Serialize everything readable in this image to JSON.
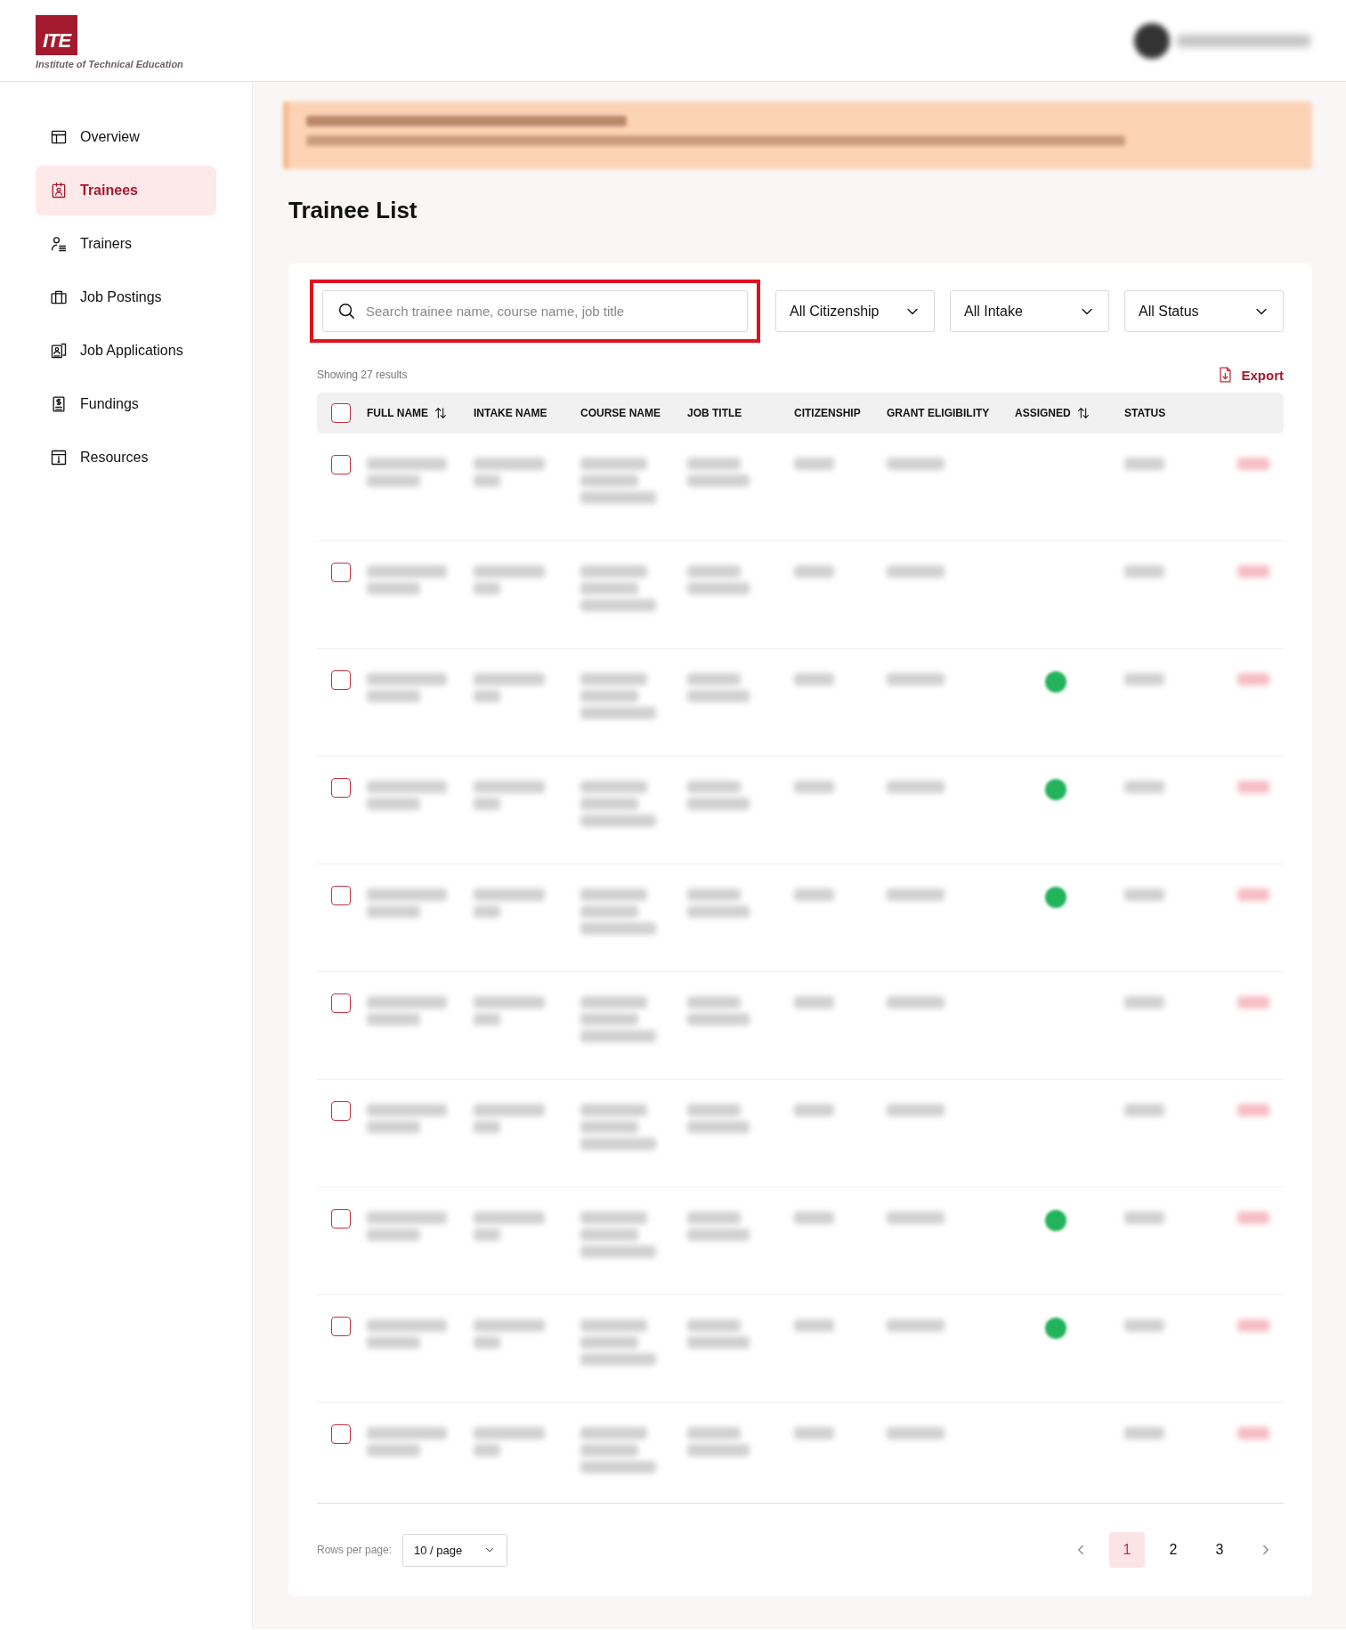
{
  "logo": {
    "mark": "ITE",
    "caption": "Institute of Technical Education"
  },
  "sidebar": {
    "items": [
      {
        "label": "Overview",
        "selected": false
      },
      {
        "label": "Trainees",
        "selected": true
      },
      {
        "label": "Trainers",
        "selected": false
      },
      {
        "label": "Job Postings",
        "selected": false
      },
      {
        "label": "Job Applications",
        "selected": false
      },
      {
        "label": "Fundings",
        "selected": false
      },
      {
        "label": "Resources",
        "selected": false
      }
    ]
  },
  "title": "Trainee List",
  "search": {
    "placeholder": "Search trainee name, course name, job title",
    "highlighted": true
  },
  "filters": [
    "All Citizenship",
    "All Intake",
    "All Status"
  ],
  "result_count": "Showing 27 results",
  "export": "Export",
  "table": {
    "columns": [
      {
        "label": "FULL NAME",
        "sortable": true
      },
      {
        "label": "INTAKE NAME",
        "sortable": false
      },
      {
        "label": "COURSE NAME",
        "sortable": false
      },
      {
        "label": "JOB TITLE",
        "sortable": false
      },
      {
        "label": "CITIZENSHIP",
        "sortable": false
      },
      {
        "label": "GRANT ELIGIBILITY",
        "sortable": false
      },
      {
        "label": "ASSIGNED",
        "sortable": true
      },
      {
        "label": "STATUS",
        "sortable": false
      }
    ],
    "header_checked": false,
    "rows": [
      {
        "checked": false,
        "assigned": false
      },
      {
        "checked": false,
        "assigned": false
      },
      {
        "checked": false,
        "assigned": true
      },
      {
        "checked": false,
        "assigned": true
      },
      {
        "checked": false,
        "assigned": true
      },
      {
        "checked": false,
        "assigned": false
      },
      {
        "checked": false,
        "assigned": false
      },
      {
        "checked": false,
        "assigned": true
      },
      {
        "checked": false,
        "assigned": true
      },
      {
        "checked": false,
        "assigned": false
      }
    ]
  },
  "pagination": {
    "rows_label": "Rows per page:",
    "page_size": "10 / page",
    "pages": [
      {
        "label": "1",
        "selected": true
      },
      {
        "label": "2",
        "selected": false
      },
      {
        "label": "3",
        "selected": false
      }
    ]
  }
}
